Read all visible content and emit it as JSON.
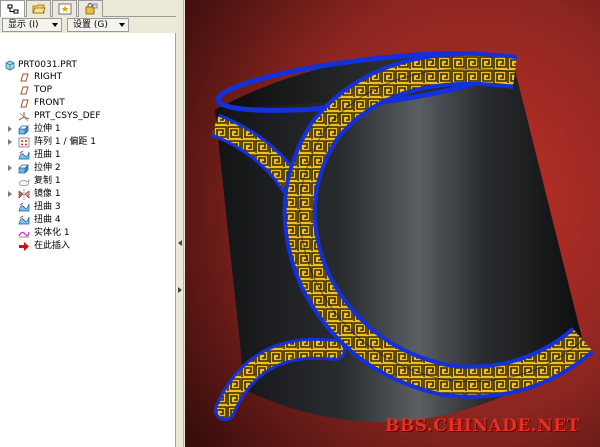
{
  "toolbar": {
    "show_label": "显示 (I)",
    "settings_label": "设置 (G)"
  },
  "tree": {
    "root": "PRT0031.PRT",
    "items": [
      {
        "label": "RIGHT",
        "icon": "datum-plane-icon",
        "expandable": false
      },
      {
        "label": "TOP",
        "icon": "datum-plane-icon",
        "expandable": false
      },
      {
        "label": "FRONT",
        "icon": "datum-plane-icon",
        "expandable": false
      },
      {
        "label": "PRT_CSYS_DEF",
        "icon": "coordinate-system-icon",
        "expandable": false
      },
      {
        "label": "拉伸 1",
        "icon": "extrude-icon",
        "expandable": true
      },
      {
        "label": "阵列 1 / 偏距 1",
        "icon": "pattern-icon",
        "expandable": true
      },
      {
        "label": "扭曲 1",
        "icon": "warp-icon",
        "expandable": false
      },
      {
        "label": "拉伸 2",
        "icon": "extrude-icon",
        "expandable": true
      },
      {
        "label": "复制 1",
        "icon": "copy-surface-icon",
        "expandable": false
      },
      {
        "label": "镜像 1",
        "icon": "mirror-icon",
        "expandable": true
      },
      {
        "label": "扭曲 3",
        "icon": "warp-icon",
        "expandable": false
      },
      {
        "label": "扭曲 4",
        "icon": "warp-icon",
        "expandable": false
      },
      {
        "label": "实体化 1",
        "icon": "solidify-icon",
        "expandable": false
      },
      {
        "label": "在此插入",
        "icon": "insert-here-arrow-icon",
        "expandable": false
      }
    ]
  },
  "watermark": "BBS.CHINADE.NET",
  "colors": {
    "background_center": "#c0302a",
    "background_edge": "#3a0e0c",
    "band_blue": "#1430d8",
    "band_gold": "#f0c020",
    "band_pattern_dark": "#3a2a00",
    "cylinder_dark": "#1c1e20"
  }
}
